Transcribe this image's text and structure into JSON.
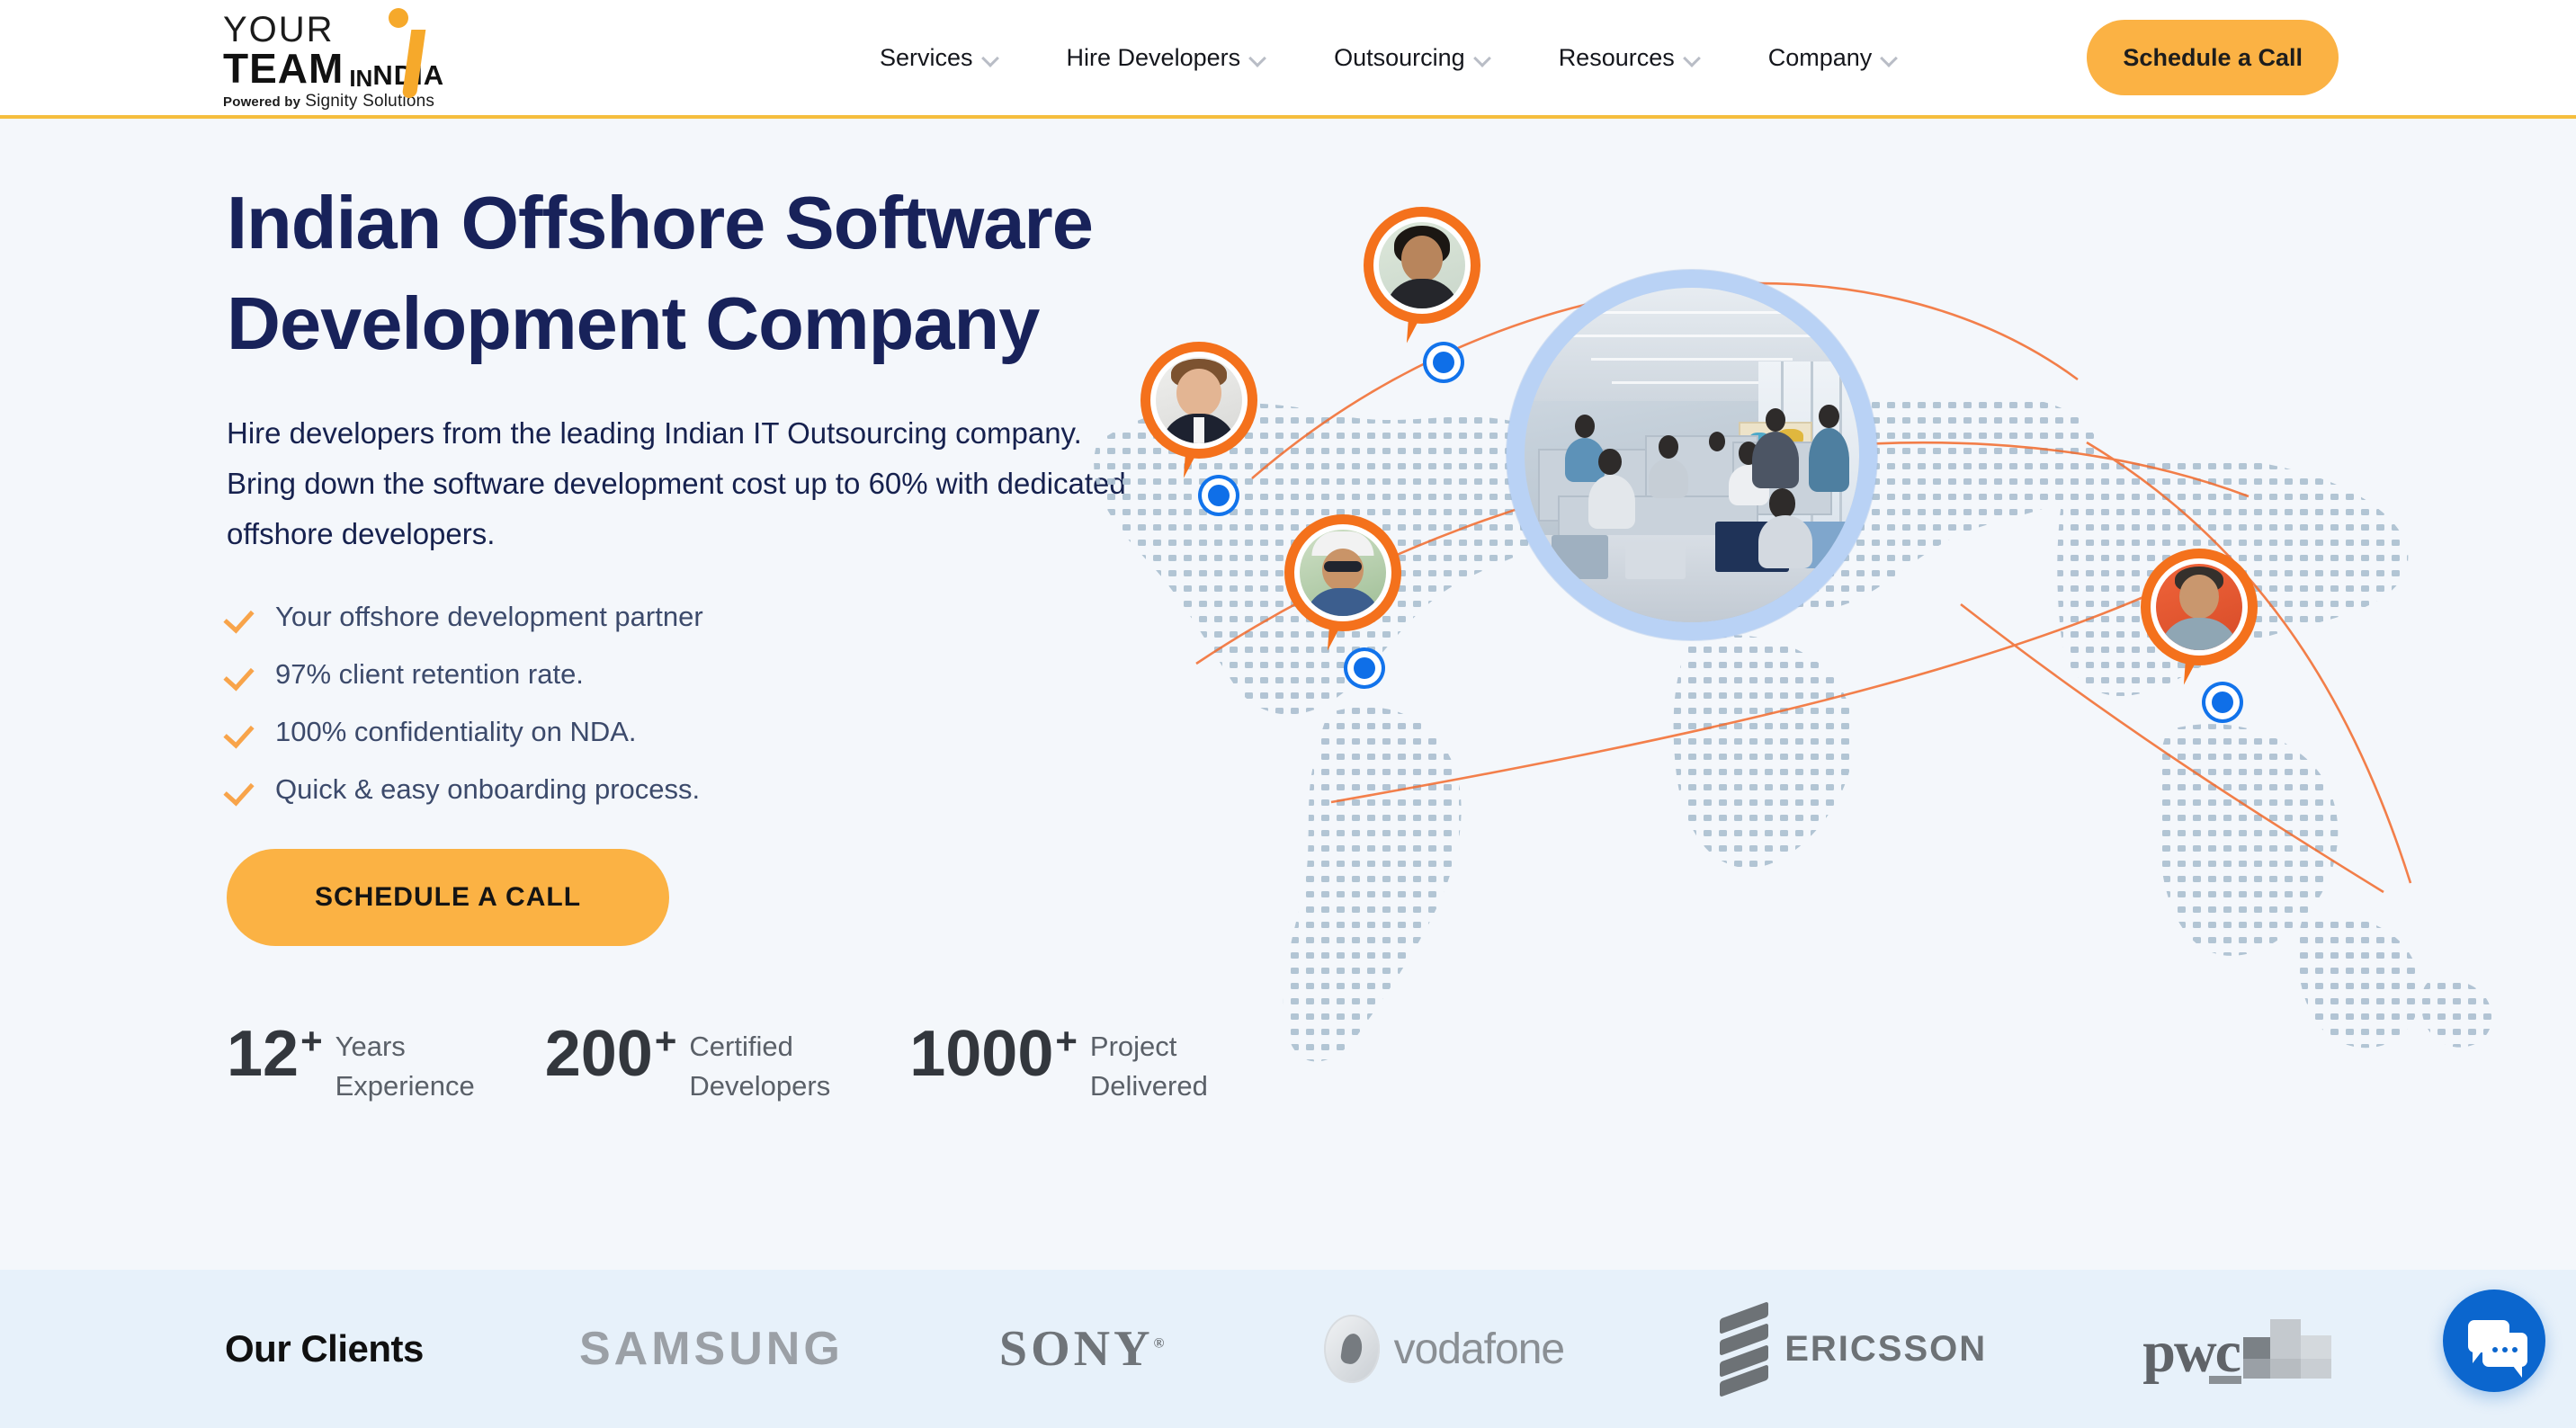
{
  "header": {
    "logo": {
      "line1": "YOUR",
      "line2": "TEAM",
      "in": "IN",
      "ndia": "NDIA",
      "powered_prefix": "Powered by",
      "powered_brand": "Signity Solutions"
    },
    "nav": [
      {
        "label": "Services",
        "icon": "chevron-down-icon"
      },
      {
        "label": "Hire Developers",
        "icon": "chevron-down-icon"
      },
      {
        "label": "Outsourcing",
        "icon": "chevron-down-icon"
      },
      {
        "label": "Resources",
        "icon": "chevron-down-icon"
      },
      {
        "label": "Company",
        "icon": "chevron-down-icon"
      }
    ],
    "cta_label": "Schedule a Call",
    "accent_color": "#FBB244",
    "border_color": "#F5BE3E"
  },
  "hero": {
    "title_line1": "Indian Offshore Software",
    "title_line2": "Development Company",
    "subtitle": "Hire developers from the leading Indian IT Outsourcing company. Bring down the software development cost up to 60% with dedicated offshore developers.",
    "bullets": [
      "Your offshore development partner",
      "97% client retention rate.",
      "100% confidentiality on NDA.",
      "Quick & easy onboarding process."
    ],
    "cta_label": "SCHEDULE A CALL",
    "title_color": "#18225A",
    "background_color": "#F4F7FB",
    "stats": [
      {
        "number": "12",
        "plus": "+",
        "label": "Years\nExperience"
      },
      {
        "number": "200",
        "plus": "+",
        "label": "Certified\nDevelopers"
      },
      {
        "number": "1000",
        "plus": "+",
        "label": "Project\nDelivered"
      }
    ],
    "art": {
      "map_icon": "dotted-world-map",
      "office_photo_icon": "office-team-photo",
      "pin_icon": "map-pin-avatar",
      "location_dot_icon": "location-dot-icon",
      "pin_color": "#F4711C",
      "dot_color": "#0F6FE8",
      "ring_color": "#B9D2F5"
    }
  },
  "clients": {
    "title": "Our Clients",
    "background_color": "#E7F1FA",
    "logos": [
      {
        "name": "SAMSUNG",
        "icon": "samsung-logo"
      },
      {
        "name": "SONY",
        "icon": "sony-logo"
      },
      {
        "name": "vodafone",
        "icon": "vodafone-logo"
      },
      {
        "name": "ERICSSON",
        "icon": "ericsson-logo"
      },
      {
        "name": "pwc",
        "icon": "pwc-logo"
      }
    ],
    "sony_trademark": "®"
  },
  "chat_widget": {
    "icon": "chat-bubbles-icon",
    "color": "#0B66CE"
  }
}
